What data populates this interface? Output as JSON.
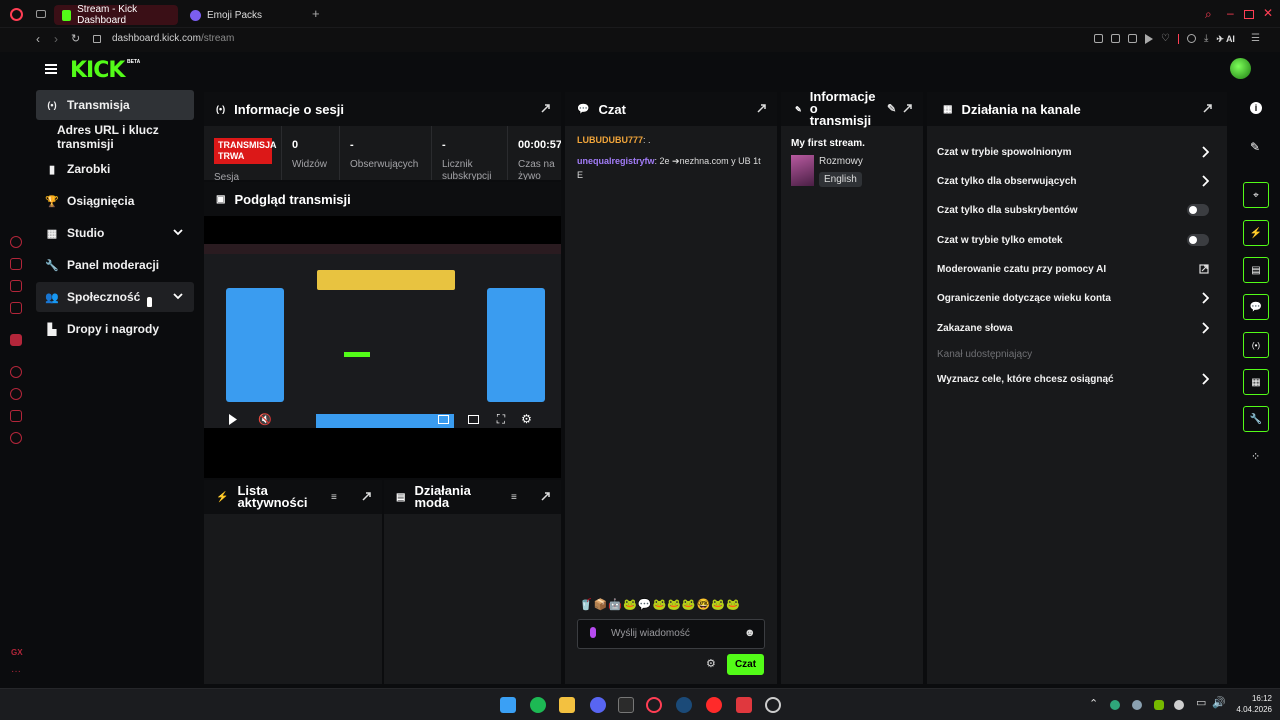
{
  "browser": {
    "tabs": [
      {
        "label": "Stream - Kick Dashboard",
        "active": true
      },
      {
        "label": "Emoji Packs",
        "active": false
      }
    ],
    "url_host": "dashboard.kick.com",
    "url_path": "/stream",
    "ai_label": "AI"
  },
  "kick": {
    "logo": "KICK",
    "beta": "BETA"
  },
  "nav": {
    "items": [
      {
        "label": "Transmisja"
      },
      {
        "label": "Adres URL i klucz transmisji"
      },
      {
        "label": "Zarobki"
      },
      {
        "label": "Osiągnięcia"
      },
      {
        "label": "Studio"
      },
      {
        "label": "Panel moderacji"
      },
      {
        "label": "Społeczność"
      },
      {
        "label": "Dropy i nagrody"
      }
    ]
  },
  "session": {
    "title": "Informacje o sesji",
    "live_badge": "TRANSMISJA TRWA",
    "live_sub": "Sesja",
    "stats": [
      {
        "value": "0",
        "label": "Widzów"
      },
      {
        "value": "-",
        "label": "Obserwujących"
      },
      {
        "value": "-",
        "label": "Licznik subskrypcji"
      },
      {
        "value": "00:00:57",
        "label": "Czas na żywo"
      }
    ]
  },
  "preview": {
    "title": "Podgląd transmisji"
  },
  "activity": {
    "title": "Lista aktywności"
  },
  "mod_actions": {
    "title": "Działania moda"
  },
  "chat": {
    "title": "Czat",
    "messages": [
      {
        "user": "LUBUDUBU777",
        "text": ": ."
      },
      {
        "user": "unequalregistryfw",
        "text": ": 2e ➔nezhna.com y UB 1t E"
      }
    ],
    "placeholder": "Wyślij wiadomość",
    "send_label": "Czat",
    "emotes": [
      "🥤",
      "📦",
      "🤖",
      "🐸",
      "💬",
      "🐸",
      "🐸",
      "🐸",
      "🤓",
      "🐸",
      "🐸"
    ]
  },
  "stream_info": {
    "title": "Informacje o transmisji",
    "stream_title": "My first stream.",
    "category": "Rozmowy",
    "language": "English"
  },
  "channel_actions": {
    "title": "Działania na kanale",
    "rows": [
      {
        "label": "Czat w trybie spowolnionym",
        "control": "arrow"
      },
      {
        "label": "Czat tylko dla obserwujących",
        "control": "arrow"
      },
      {
        "label": "Czat tylko dla subskrybentów",
        "control": "toggle"
      },
      {
        "label": "Czat w trybie tylko emotek",
        "control": "toggle"
      },
      {
        "label": "Moderowanie czatu przy pomocy AI",
        "control": "external"
      },
      {
        "label": "Ograniczenie dotyczące wieku konta",
        "control": "arrow"
      },
      {
        "label": "Zakazane słowa",
        "control": "arrow"
      },
      {
        "label": "Kanał udostępniający",
        "control": "none"
      },
      {
        "label": "Wyznacz cele, które chcesz osiągnąć",
        "control": "arrow"
      }
    ]
  },
  "taskbar": {
    "time": "16:12",
    "date": "4.04.2026"
  },
  "colors": {
    "brand": "#53fc18",
    "live": "#dc1818",
    "username_orange": "#f0a43a",
    "username_purple": "#a27cf8"
  }
}
